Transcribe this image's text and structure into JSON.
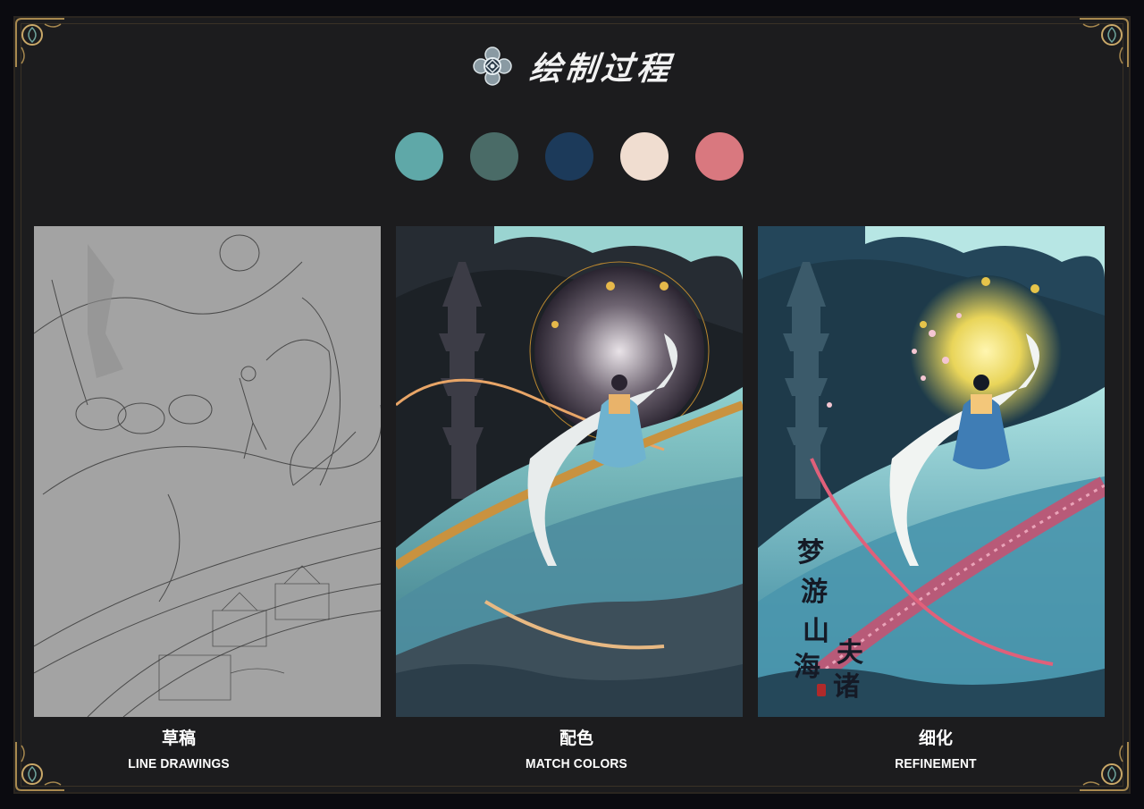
{
  "header": {
    "title": "绘制过程",
    "emblem_icon": "flower-knot-emblem-icon"
  },
  "palette": {
    "colors": [
      "#5fa8a8",
      "#4a6b67",
      "#1c3a5a",
      "#f0ddd0",
      "#d9787f"
    ]
  },
  "stages": [
    {
      "title_zh": "草稿",
      "title_en": "LINE DRAWINGS",
      "image": "pencil-sketch-illustration"
    },
    {
      "title_zh": "配色",
      "title_en": "MATCH COLORS",
      "image": "flat-color-illustration"
    },
    {
      "title_zh": "细化",
      "title_en": "REFINEMENT",
      "image": "finished-illustration"
    }
  ],
  "artwork": {
    "poster_title_chars": [
      "梦",
      "游",
      "山",
      "海",
      "夫",
      "诸"
    ]
  },
  "colors": {
    "background": "#0b0b10",
    "panel_background": "#1c1c1e",
    "text": "#ffffff",
    "gold_ornament": "#a8894f"
  }
}
